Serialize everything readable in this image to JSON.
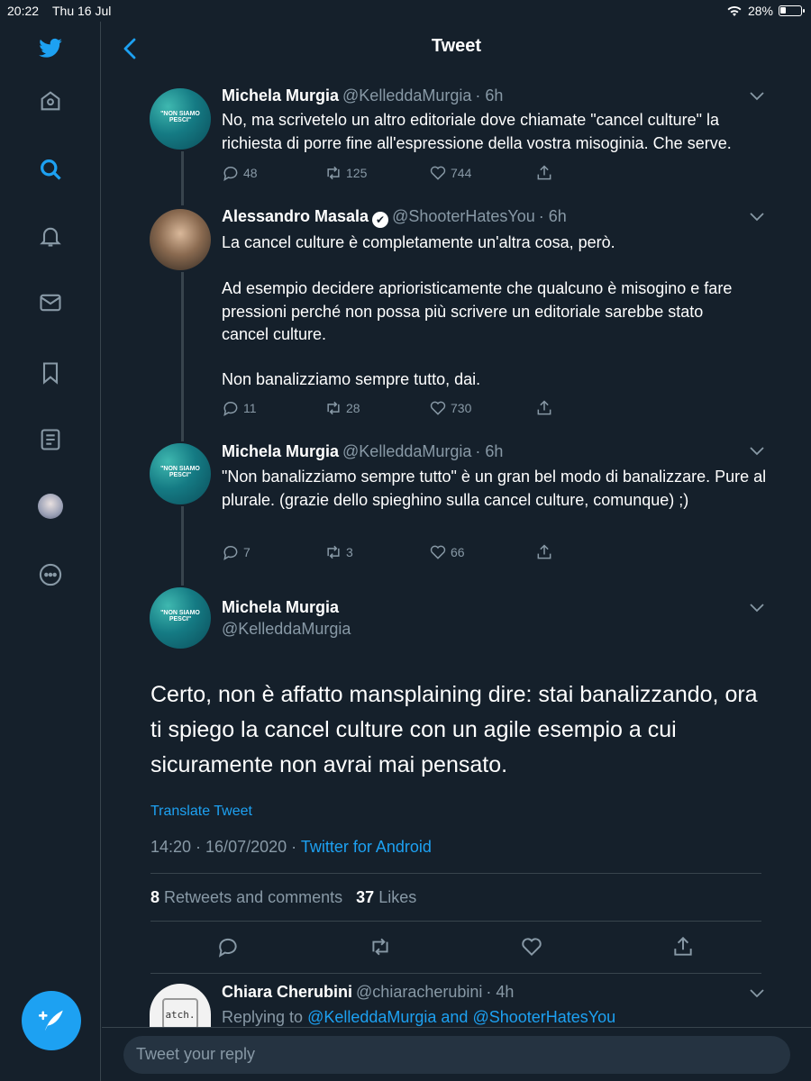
{
  "status_bar": {
    "time": "20:22",
    "date": "Thu 16 Jul",
    "battery": "28%",
    "battery_level": 0.28
  },
  "header": {
    "title": "Tweet"
  },
  "sidebar": {
    "icons": [
      "twitter-bird-icon",
      "home-icon",
      "search-icon",
      "notifications-icon",
      "messages-icon",
      "bookmarks-icon",
      "lists-icon",
      "profile-avatar",
      "more-icon"
    ],
    "active": "search-icon",
    "compose": "compose-tweet-icon"
  },
  "thread": [
    {
      "name": "Michela Murgia",
      "handle": "@KelleddaMurgia",
      "time": "· 6h",
      "avatar_text": "\"NON SIAMO PESCI\"",
      "text": "No, ma scrivetelo un altro editoriale dove chiamate \"cancel culture\" la richiesta di porre fine all'espressione della vostra misoginia. Che serve.",
      "replies": "48",
      "retweets": "125",
      "likes": "744"
    },
    {
      "name": "Alessandro Masala",
      "handle": "@ShooterHatesYou",
      "time": "· 6h",
      "verified": true,
      "text_lines": [
        "La cancel culture è completamente un'altra cosa, però.",
        "Ad esempio decidere aprioristicamente che qualcuno è misogino e fare pressioni perché non possa più scrivere un editoriale sarebbe stato cancel culture.",
        "Non banalizziamo sempre tutto, dai."
      ],
      "replies": "11",
      "retweets": "28",
      "likes": "730"
    },
    {
      "name": "Michela Murgia",
      "handle": "@KelleddaMurgia",
      "time": "· 6h",
      "avatar_text": "\"NON SIAMO PESCI\"",
      "text": "\"Non banalizziamo sempre tutto\" è un gran bel modo di banalizzare. Pure al plurale. (grazie dello spieghino sulla cancel culture, comunque) ;)",
      "replies": "7",
      "retweets": "3",
      "likes": "66"
    }
  ],
  "main_tweet": {
    "name": "Michela Murgia",
    "handle": "@KelleddaMurgia",
    "avatar_text": "\"NON SIAMO PESCI\"",
    "text": "Certo, non è affatto mansplaining dire: stai banalizzando, ora ti spiego la cancel culture con un agile esempio a cui sicuramente non avrai mai pensato.",
    "translate": "Translate Tweet",
    "timestamp": "14:20 · 16/07/2020 · ",
    "source": "Twitter for Android",
    "retweets_count": "8",
    "retweets_label": "Retweets and comments",
    "likes_count": "37",
    "likes_label": "Likes"
  },
  "reply": {
    "name": "Chiara Cherubini",
    "handle": "@chiaracherubini",
    "time": "· 4h",
    "avatar_text": "atch.",
    "replying_prefix": "Replying to ",
    "replying_to": "@KelleddaMurgia and @ShooterHatesYou"
  },
  "composer": {
    "placeholder": "Tweet your reply"
  },
  "colors": {
    "background": "#15202b",
    "accent": "#1da1f2",
    "muted": "#8899a6",
    "divider": "#38444d"
  }
}
